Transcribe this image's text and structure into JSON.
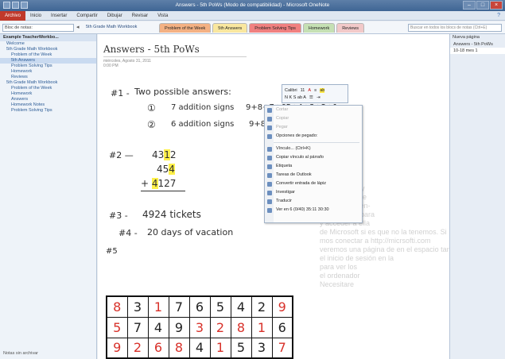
{
  "window": {
    "title": "Answers - 5th PoWs (Modo de compatibilidad) - Microsoft OneNote"
  },
  "menu": {
    "items": [
      "Archivo",
      "Inicio",
      "Insertar",
      "Compartir",
      "Dibujar",
      "Revisar",
      "Vista"
    ]
  },
  "toolbar": {
    "notebook_dropdown": "Bloc de notas:",
    "breadcrumb": "5th Grade Math Workbook",
    "search_placeholder": "Buscar en todos los blocs de notas (Ctrl+E)"
  },
  "section_tabs": [
    {
      "label": "Problem of the Week",
      "color": "#f4b183"
    },
    {
      "label": "5th Answers",
      "color": "#f9e79f"
    },
    {
      "label": "Problem Solving Tips",
      "color": "#f08080"
    },
    {
      "label": "Homework",
      "color": "#c5e0b4"
    },
    {
      "label": "Reviews",
      "color": "#f2c9c9"
    }
  ],
  "nav_pane": {
    "items": [
      {
        "label": "Example TeacherWorkbo...",
        "level": 0
      },
      {
        "label": "Welcome",
        "level": 1
      },
      {
        "label": "5th Grade Math Workbook",
        "level": 1
      },
      {
        "label": "Problem of the Week",
        "level": 2
      },
      {
        "label": "5th Answers",
        "level": 2,
        "selected": true
      },
      {
        "label": "Problem Solving Tips",
        "level": 2
      },
      {
        "label": "Homework",
        "level": 2
      },
      {
        "label": "Reviews",
        "level": 2
      },
      {
        "label": "5th Grade Math Workbook",
        "level": 1
      },
      {
        "label": "Problem of the Week",
        "level": 2
      },
      {
        "label": "Homework",
        "level": 2
      },
      {
        "label": "Answers",
        "level": 2
      },
      {
        "label": "Homework Notes",
        "level": 2
      },
      {
        "label": "Problem Solving Tips",
        "level": 2
      }
    ],
    "bottom": "Notas sin archivar"
  },
  "page": {
    "title": "Answers - 5th PoWs",
    "date": "miércoles, Agosto 31, 2011",
    "time": "0:00 PM"
  },
  "handwriting": {
    "p1_label": "#1 -",
    "p1_text": "Two possible answers:",
    "p1_opt1_num": "①",
    "p1_opt1_text": "7 addition signs",
    "p1_opt1_eq": "9+8+7+65+4+3+2+1",
    "p1_opt2_num": "②",
    "p1_opt2_text": "6 addition signs",
    "p1_opt2_eq": "9+8+7+6+5+43+21",
    "p2_label": "#2 —",
    "p2_line1_a": "43",
    "p2_line1_b": "1",
    "p2_line1_c": "2",
    "p2_line2_a": "45",
    "p2_line2_b": "4",
    "p2_line3_a": "+ ",
    "p2_line3_b": "4",
    "p2_line3_c": "127",
    "p3_label": "#3 -",
    "p3_text": "4924 tickets",
    "p4_label": "#4 -",
    "p4_text": "20 days of vacation",
    "p5_label": "#5"
  },
  "grid": [
    [
      {
        "v": "8",
        "c": "red"
      },
      {
        "v": "3",
        "c": "blk"
      },
      {
        "v": "1",
        "c": "red"
      },
      {
        "v": "7",
        "c": "blk"
      },
      {
        "v": "6",
        "c": "blk"
      },
      {
        "v": "5",
        "c": "blk"
      },
      {
        "v": "4",
        "c": "blk"
      },
      {
        "v": "2",
        "c": "blk"
      },
      {
        "v": "9",
        "c": "red"
      }
    ],
    [
      {
        "v": "5",
        "c": "red"
      },
      {
        "v": "7",
        "c": "blk"
      },
      {
        "v": "4",
        "c": "blk"
      },
      {
        "v": "9",
        "c": "blk"
      },
      {
        "v": "3",
        "c": "red"
      },
      {
        "v": "2",
        "c": "red"
      },
      {
        "v": "8",
        "c": "red"
      },
      {
        "v": "1",
        "c": "red"
      },
      {
        "v": "6",
        "c": "blk"
      }
    ],
    [
      {
        "v": "9",
        "c": "red"
      },
      {
        "v": "2",
        "c": "red"
      },
      {
        "v": "6",
        "c": "red"
      },
      {
        "v": "8",
        "c": "red"
      },
      {
        "v": "4",
        "c": "blk"
      },
      {
        "v": "1",
        "c": "red"
      },
      {
        "v": "5",
        "c": "blk"
      },
      {
        "v": "3",
        "c": "blk"
      },
      {
        "v": "7",
        "c": "red"
      }
    ]
  ],
  "mini_toolbar": {
    "font": "Calibri",
    "size": "11",
    "row2": "N K S ab A"
  },
  "context_menu": [
    {
      "label": "Cortar",
      "dim": true
    },
    {
      "label": "Copiar",
      "dim": true
    },
    {
      "label": "Pegar",
      "dim": true
    },
    {
      "label": "Opciones de pegado:",
      "dim": false
    },
    {
      "sep": true
    },
    {
      "label": "Vínculo... (Ctrl+K)",
      "dim": false
    },
    {
      "label": "Copiar vínculo al párrafo",
      "dim": false
    },
    {
      "label": "Etiqueta",
      "dim": false
    },
    {
      "label": "Tareas de Outlook",
      "dim": false
    },
    {
      "label": "Convertir entrada de lápiz",
      "dim": false
    },
    {
      "label": "Investigar",
      "dim": false
    },
    {
      "label": "Traducir",
      "dim": false
    },
    {
      "label": "Ver en 6 (0/40) 35:11 30:30",
      "dim": false
    }
  ],
  "background_text": [
    "e",
    "da V",
    "aplicaciones y",
    "vicios web que",
    "mpatibilidad en-",
    "e especiado para",
    "y acceder a ella",
    "de Microsoft si es que no la tenemos. Si",
    "mos conectar a http://micrsofti.com",
    "veremos una página de en el espacio tan",
    "el inicio de sesión en la",
    "para ver los",
    "el ordenador",
    "Necesitare"
  ],
  "page_list": {
    "new_page": "Nueva página",
    "items": [
      {
        "label": "Answers - 5th PoWs",
        "selected": false
      },
      {
        "label": "10-18 mes 1",
        "selected": true
      }
    ]
  }
}
